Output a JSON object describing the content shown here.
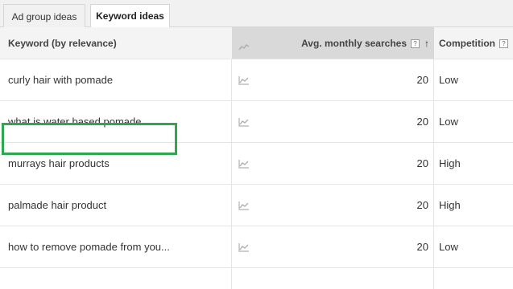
{
  "tabs": [
    {
      "label": "Ad group ideas",
      "active": false
    },
    {
      "label": "Keyword ideas",
      "active": true
    }
  ],
  "header": {
    "keyword": "Keyword (by relevance)",
    "searches": "Avg. monthly searches",
    "competition": "Competition",
    "help": "?",
    "sort": "↑"
  },
  "rows": [
    {
      "keyword": "",
      "searches": "",
      "competition": ""
    },
    {
      "keyword": "curly hair with pomade",
      "searches": "20",
      "competition": "Low"
    },
    {
      "keyword": "what is water based pomade",
      "searches": "20",
      "competition": "Low"
    },
    {
      "keyword": "murrays hair products",
      "searches": "20",
      "competition": "High"
    },
    {
      "keyword": "palmade hair product",
      "searches": "20",
      "competition": "High"
    },
    {
      "keyword": "how to remove pomade from you...",
      "searches": "20",
      "competition": "Low"
    }
  ],
  "colors": {
    "highlight": "#2ea84f",
    "sorted_header": "#d9d9d9"
  }
}
